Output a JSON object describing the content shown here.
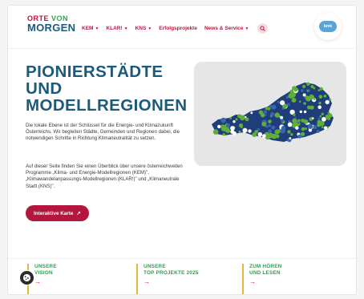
{
  "header": {
    "logo_line1_a": "ORTE ",
    "logo_line1_b": "VON",
    "logo_line2": "MORGEN",
    "nav": [
      {
        "label": "KEM"
      },
      {
        "label": "KLAR!"
      },
      {
        "label": "KNS"
      },
      {
        "label": "Erfolgsprojekte"
      },
      {
        "label": "News & Service"
      }
    ],
    "badge_text": "bmk"
  },
  "hero": {
    "title_lines": [
      "PIONIERSTÄDTE",
      "UND",
      "MODELLREGIONEN"
    ],
    "paragraph1": "Die lokale Ebene ist der Schlüssel für die Energie- und Klimazukunft Österreichs. Wir begleiten Städte, Gemeinden und Regionen dabei, die notwendigen Schritte in Richtung Klimaneutralität zu setzen.",
    "paragraph2": "Auf dieser Seite finden Sie einen Überblick über unsere österreichweiten Programme „Klima- und Energie-Modellregionen (KEM)\", „Klimawandelanpassungs-Modellregionen (KLAR!)\" und „Klimaneutrale Stadt (KNS)\".",
    "cta_label": "Interaktive Karte",
    "cta_icon": "↗"
  },
  "teasers": [
    {
      "line1": "UNSERE",
      "line2": "VISION",
      "arrow": "→"
    },
    {
      "line1": "UNSERE",
      "line2": "TOP PROJEKTE 2025",
      "arrow": "→"
    },
    {
      "line1": "ZUM HÖREN",
      "line2": "UND LESEN",
      "arrow": "→"
    }
  ],
  "colors": {
    "brand_red": "#c0133a",
    "brand_blue": "#1c5a7b",
    "brand_green": "#2aa34a",
    "map_navy": "#1f3d7a",
    "map_green": "#5fae3a",
    "map_bg": "#e6e6e6"
  }
}
